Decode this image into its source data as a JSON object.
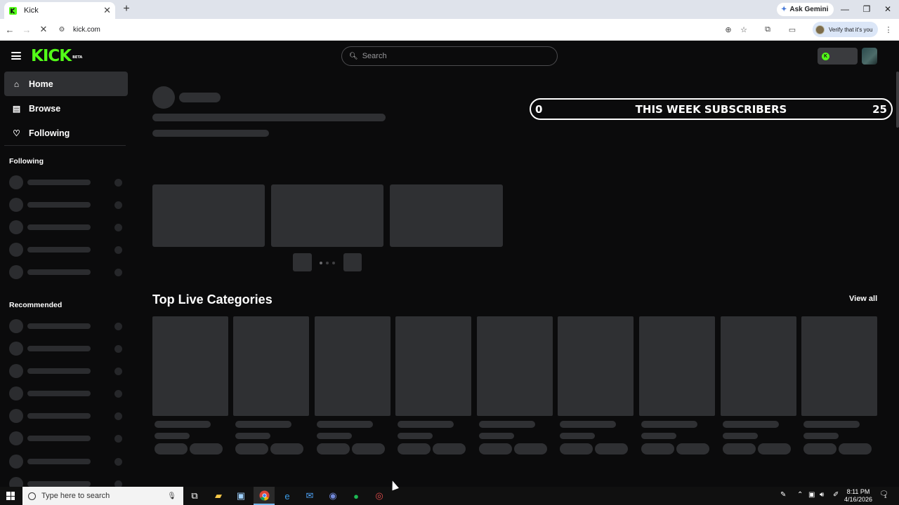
{
  "browser": {
    "tab_title": "Kick",
    "new_tab": "+",
    "ask_gemini": "Ask Gemini",
    "url": "kick.com",
    "verify_label": "Verify that it's you"
  },
  "header": {
    "logo": "KICK",
    "logo_badge": "BETA",
    "search_placeholder": "Search"
  },
  "sidebar": {
    "nav": [
      {
        "label": "Home",
        "icon": "home-icon",
        "active": true
      },
      {
        "label": "Browse",
        "icon": "browse-icon",
        "active": false
      },
      {
        "label": "Following",
        "icon": "heart-icon",
        "active": false
      }
    ],
    "following_heading": "Following",
    "recommended_heading": "Recommended"
  },
  "main": {
    "subscriber_banner": {
      "left_value": "0",
      "title": "THIS WEEK SUBSCRIBERS",
      "right_value": "25"
    },
    "top_categories_title": "Top Live Categories",
    "view_all": "View all"
  },
  "taskbar": {
    "search_placeholder": "Type here to search",
    "time": "8:11 PM",
    "date": "4/16/2026",
    "notification_count": "1"
  },
  "colors": {
    "brand": "#53fc18",
    "background": "#0b0b0c",
    "skeleton": "#2f3033"
  }
}
